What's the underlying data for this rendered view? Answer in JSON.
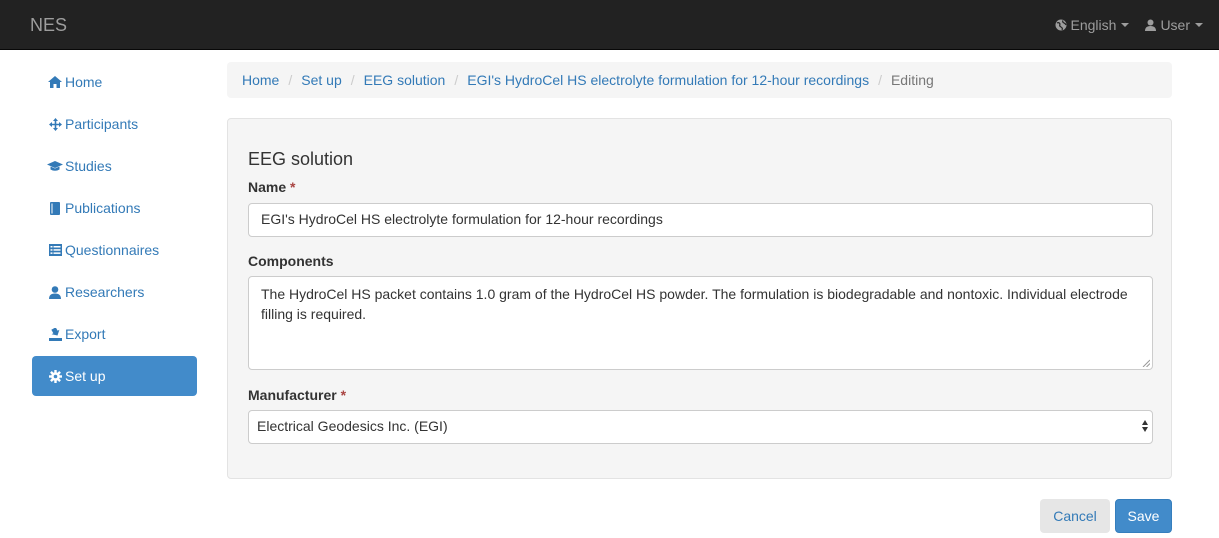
{
  "navbar": {
    "brand": "NES",
    "language": "English",
    "user": "User"
  },
  "sidebar": {
    "items": [
      {
        "label": "Home",
        "icon": "home-icon"
      },
      {
        "label": "Participants",
        "icon": "move-icon"
      },
      {
        "label": "Studies",
        "icon": "graduation-cap-icon"
      },
      {
        "label": "Publications",
        "icon": "book-icon"
      },
      {
        "label": "Questionnaires",
        "icon": "list-icon"
      },
      {
        "label": "Researchers",
        "icon": "user-icon"
      },
      {
        "label": "Export",
        "icon": "export-icon"
      },
      {
        "label": "Set up",
        "icon": "gear-icon",
        "active": true
      }
    ]
  },
  "breadcrumb": {
    "items": [
      "Home",
      "Set up",
      "EEG solution",
      "EGI's HydroCel HS electrolyte formulation for 12-hour recordings"
    ],
    "current": "Editing"
  },
  "form": {
    "title": "EEG solution",
    "name_label": "Name",
    "name_value": "EGI's HydroCel HS electrolyte formulation for 12-hour recordings",
    "components_label": "Components",
    "components_value": "The HydroCel HS packet contains 1.0 gram of the HydroCel HS powder. The formulation is biodegradable and nontoxic. Individual electrode filling is required.",
    "manufacturer_label": "Manufacturer",
    "manufacturer_value": "Electrical Geodesics Inc. (EGI)",
    "required_mark": "*"
  },
  "actions": {
    "cancel": "Cancel",
    "save": "Save"
  },
  "colors": {
    "navbar_bg": "#222222",
    "link": "#337ab7",
    "active": "#428bca",
    "required": "#a94442"
  }
}
